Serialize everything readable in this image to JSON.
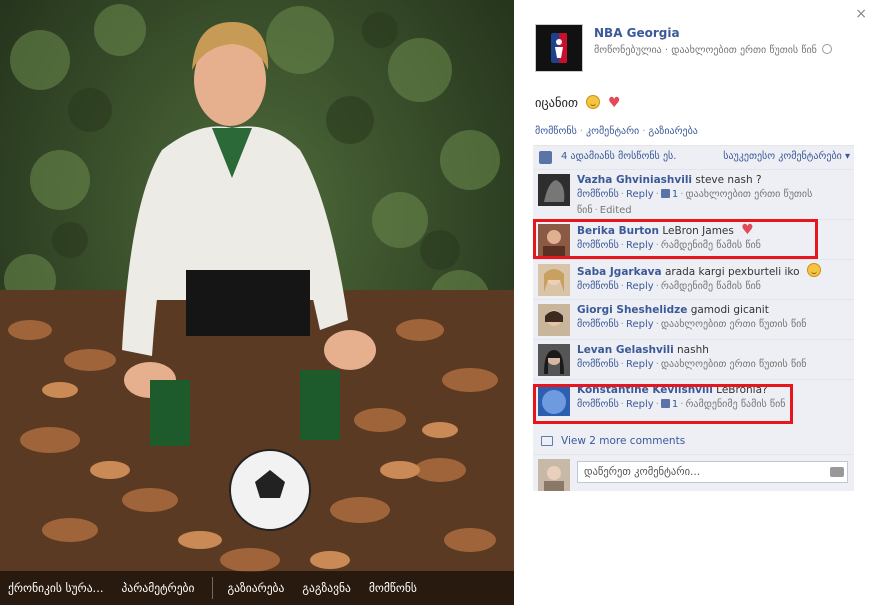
{
  "photo": {
    "actions": [
      "ქრონიკის სურა...",
      "პარამეტრები",
      "გაზიარება",
      "გაგზავნა",
      "მომწონს"
    ]
  },
  "close_label": "×",
  "page": {
    "name": "NBA Georgia",
    "meta": "მოწონებულია · დაახლოებით ერთი წუთის წინ"
  },
  "post": {
    "text": "იცანით",
    "actions": {
      "like": "მომწონს",
      "comment": "კომენტარი",
      "share": "გაზიარება"
    }
  },
  "likes": {
    "text": "4 ადამიანს მოსწონს ეს.",
    "sort": "საუკეთესო კომენტარები ▾"
  },
  "comments": [
    {
      "author": "Vazha Ghviniashvili",
      "text": "steve nash ?",
      "like": "მომწონს",
      "reply": "Reply",
      "likes_count": "1",
      "time": "დაახლოებით ერთი წუთის წინ",
      "edited": "Edited"
    },
    {
      "author": "Berika Burton",
      "text": "LeBron James",
      "like": "მომწონს",
      "reply": "Reply",
      "likes_count": "",
      "time": "რამდენიმე წამის წინ",
      "edited": ""
    },
    {
      "author": "Saba Jgarkava",
      "text": "arada kargi pexburteli iko",
      "like": "მომწონს",
      "reply": "Reply",
      "likes_count": "",
      "time": "რამდენიმე წამის წინ",
      "edited": ""
    },
    {
      "author": "Giorgi Sheshelidze",
      "text": "gamodi gicanit",
      "like": "მომწონს",
      "reply": "Reply",
      "likes_count": "",
      "time": "დაახლოებით ერთი წუთის წინ",
      "edited": ""
    },
    {
      "author": "Levan Gelashvili",
      "text": "nashh",
      "like": "მომწონს",
      "reply": "Reply",
      "likes_count": "",
      "time": "დაახლოებით ერთი წუთის წინ",
      "edited": ""
    },
    {
      "author": "Konstantine Kevlishvili",
      "text": "LeBronia?",
      "like": "მომწონს",
      "reply": "Reply",
      "likes_count": "1",
      "time": "რამდენიმე წამის წინ",
      "edited": ""
    }
  ],
  "view_more": "View 2 more comments",
  "write_placeholder": "დაწერეთ კომენტარი...",
  "colors": {
    "link": "#3b5998",
    "highlight": "#e8161c",
    "panel": "#edeff4"
  }
}
